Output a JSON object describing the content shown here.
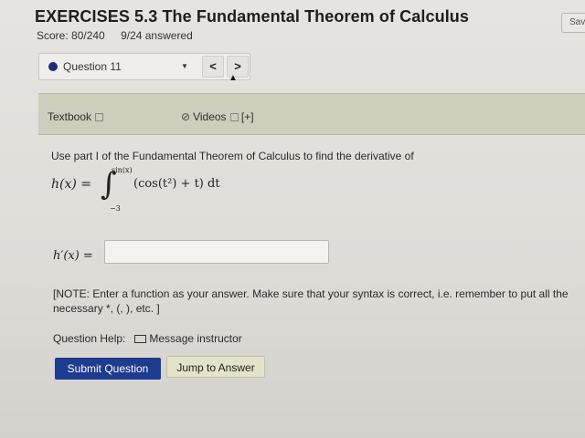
{
  "header": {
    "title": "EXERCISES 5.3 The Fundamental Theorem of Calculus",
    "score": "Score: 80/240",
    "answered": "9/24 answered",
    "save_label": "Sav"
  },
  "question_nav": {
    "selected": "Question 11",
    "prev_label": "<",
    "next_label": ">"
  },
  "resources": {
    "textbook_label": "Textbook",
    "videos_label": "Videos",
    "videos_extra": "[+]"
  },
  "problem": {
    "prompt": "Use part I of the Fundamental Theorem of Calculus to find the derivative of",
    "lhs": "h(x) =",
    "integral_sign": "∫",
    "upper_limit": "sin(x)",
    "lower_limit": "−3",
    "integrand": "(cos(t²) + t) dt",
    "answer_label": "h′(x) =",
    "answer_value": ""
  },
  "note": "[NOTE: Enter a function as your answer. Make sure that your syntax is correct, i.e. remember to put all the necessary *, (, ), etc. ]",
  "help": {
    "label": "Question Help:",
    "message_label": "Message instructor"
  },
  "actions": {
    "submit_label": "Submit Question",
    "jump_label": "Jump to Answer"
  },
  "colors": {
    "primary_button": "#1d3b8f",
    "resource_bar": "#cfcdbb",
    "secondary_button": "#e4e2c9"
  }
}
